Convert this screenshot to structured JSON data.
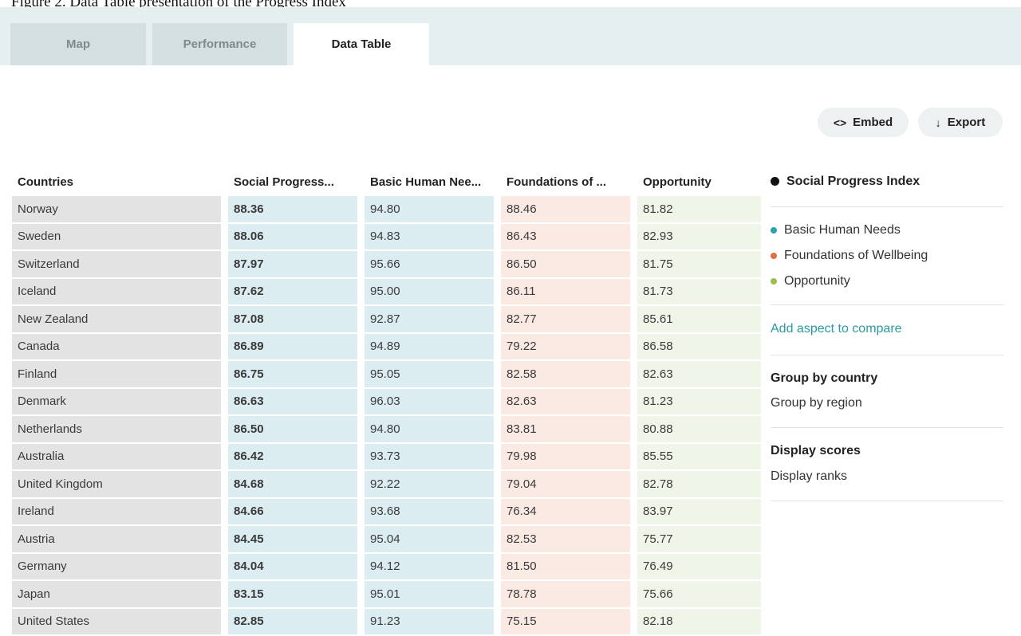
{
  "caption": "Figure 2. Data Table presentation of the Progress Index",
  "tabs": [
    {
      "label": "Map"
    },
    {
      "label": "Performance"
    },
    {
      "label": "Data Table"
    }
  ],
  "actions": {
    "embed_icon": "<>",
    "embed_label": "Embed",
    "export_icon": "↓",
    "export_label": "Export"
  },
  "table": {
    "headers": [
      "Countries",
      "Social Progress...",
      "Basic Human Nee...",
      "Foundations of ...",
      "Opportunity"
    ],
    "rows": [
      [
        "Norway",
        "88.36",
        "94.80",
        "88.46",
        "81.82"
      ],
      [
        "Sweden",
        "88.06",
        "94.83",
        "86.43",
        "82.93"
      ],
      [
        "Switzerland",
        "87.97",
        "95.66",
        "86.50",
        "81.75"
      ],
      [
        "Iceland",
        "87.62",
        "95.00",
        "86.11",
        "81.73"
      ],
      [
        "New Zealand",
        "87.08",
        "92.87",
        "82.77",
        "85.61"
      ],
      [
        "Canada",
        "86.89",
        "94.89",
        "79.22",
        "86.58"
      ],
      [
        "Finland",
        "86.75",
        "95.05",
        "82.58",
        "82.63"
      ],
      [
        "Denmark",
        "86.63",
        "96.03",
        "82.63",
        "81.23"
      ],
      [
        "Netherlands",
        "86.50",
        "94.80",
        "83.81",
        "80.88"
      ],
      [
        "Australia",
        "86.42",
        "93.73",
        "79.98",
        "85.55"
      ],
      [
        "United Kingdom",
        "84.68",
        "92.22",
        "79.04",
        "82.78"
      ],
      [
        "Ireland",
        "84.66",
        "93.68",
        "76.34",
        "83.97"
      ],
      [
        "Austria",
        "84.45",
        "95.04",
        "82.53",
        "75.77"
      ],
      [
        "Germany",
        "84.04",
        "94.12",
        "81.50",
        "76.49"
      ],
      [
        "Japan",
        "83.15",
        "95.01",
        "78.78",
        "75.66"
      ],
      [
        "United States",
        "82.85",
        "91.23",
        "75.15",
        "82.18"
      ]
    ]
  },
  "legend": {
    "main": {
      "label": "Social Progress Index",
      "color": "#111111"
    },
    "items": [
      {
        "label": "Basic Human Needs",
        "color": "#2aa3ad"
      },
      {
        "label": "Foundations of Wellbeing",
        "color": "#e0713f"
      },
      {
        "label": "Opportunity",
        "color": "#9bbf4e"
      }
    ]
  },
  "compare_link": "Add aspect to compare",
  "grouping": {
    "selected": "Group by country",
    "option": "Group by region"
  },
  "display": {
    "selected": "Display scores",
    "option": "Display ranks"
  },
  "colors": {
    "tab_bar": "#e6eff0",
    "col_countries": "#e3e3e3",
    "col_spi": "#dcedf2",
    "col_foundations": "#fbe9e4",
    "col_opportunity": "#eff5e8",
    "link": "#2a9aa3"
  }
}
